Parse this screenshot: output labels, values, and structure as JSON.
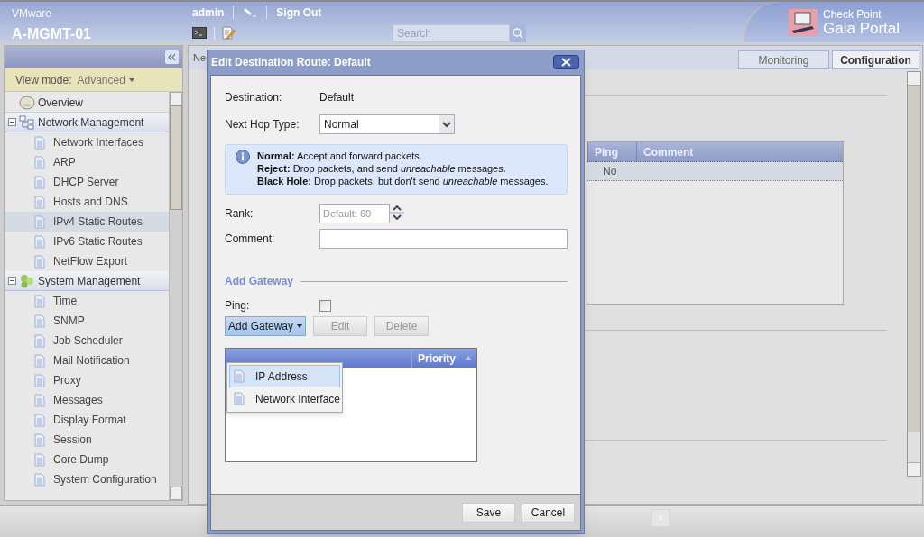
{
  "header": {
    "vendor": "VMware",
    "hostname": "A-MGMT-01",
    "user": "admin",
    "sign_out": "Sign Out",
    "search": {
      "placeholder": "Search"
    },
    "logo": {
      "line1": "Check Point",
      "line2": "Gaia Portal"
    }
  },
  "sidebar": {
    "view_mode_label": "View mode:",
    "view_mode": "Advanced",
    "items": [
      {
        "label": "Overview",
        "kind": "top",
        "selected": false
      },
      {
        "label": "Network Management",
        "kind": "network",
        "expanded": true,
        "children": [
          {
            "label": "Network Interfaces",
            "selected": false
          },
          {
            "label": "ARP",
            "selected": false
          },
          {
            "label": "DHCP Server",
            "selected": false
          },
          {
            "label": "Hosts and DNS",
            "selected": false
          },
          {
            "label": "IPv4 Static Routes",
            "selected": true
          },
          {
            "label": "IPv6 Static Routes",
            "selected": false
          },
          {
            "label": "NetFlow Export",
            "selected": false
          }
        ]
      },
      {
        "label": "System Management",
        "kind": "system",
        "expanded": true,
        "children": [
          {
            "label": "Time",
            "selected": false
          },
          {
            "label": "SNMP",
            "selected": false
          },
          {
            "label": "Job Scheduler",
            "selected": false
          },
          {
            "label": "Mail Notification",
            "selected": false
          },
          {
            "label": "Proxy",
            "selected": false
          },
          {
            "label": "Messages",
            "selected": false
          },
          {
            "label": "Display Format",
            "selected": false
          },
          {
            "label": "Session",
            "selected": false
          },
          {
            "label": "Core Dump",
            "selected": false
          },
          {
            "label": "System Configuration",
            "selected": false
          }
        ]
      }
    ]
  },
  "main": {
    "breadcrumb": "Ne",
    "tabs": [
      {
        "label": "Monitoring",
        "selected": false
      },
      {
        "label": "Configuration",
        "selected": true
      }
    ],
    "table": {
      "columns": [
        "Ping",
        "Comment"
      ],
      "rows": [
        [
          "No"
        ]
      ]
    }
  },
  "dialog": {
    "title": "Edit Destination Route: Default",
    "destination_label": "Destination:",
    "destination": "Default",
    "next_hop_label": "Next Hop Type:",
    "next_hop": "Normal",
    "info": [
      "**Normal:** Accept and forward packets.",
      "**Reject:** Drop packets, and send *unreachable* messages.",
      "**Black Hole:** Drop packets, but don't send *unreachable* messages."
    ],
    "rank_label": "Rank:",
    "rank": {
      "placeholder": "Default: 60"
    },
    "comment_label": "Comment:",
    "section": "Add Gateway",
    "ping_label": "Ping:",
    "ping_checked": false,
    "buttons": [
      {
        "label": "Add Gateway",
        "kind": "menu",
        "disabled": false
      },
      {
        "label": "Edit",
        "kind": "plain",
        "disabled": true
      },
      {
        "label": "Delete",
        "kind": "plain",
        "disabled": true
      }
    ],
    "menu": [
      {
        "label": "IP Address",
        "selected": true
      },
      {
        "label": "Network Interface",
        "selected": false
      }
    ],
    "gateway_table": {
      "columns": [
        "Priority"
      ]
    },
    "footer_buttons": [
      "Save",
      "Cancel"
    ]
  }
}
